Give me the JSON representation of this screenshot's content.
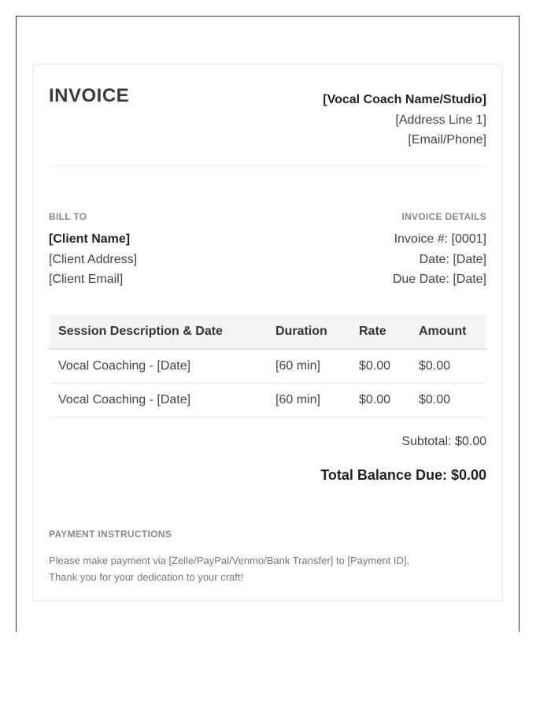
{
  "invoice": {
    "title": "INVOICE"
  },
  "studio": {
    "name": "[Vocal Coach Name/Studio]",
    "address": "[Address Line 1]",
    "contact": "[Email/Phone]"
  },
  "bill_to": {
    "label": "BILL TO",
    "client_name": "[Client Name]",
    "client_address": "[Client Address]",
    "client_email": "[Client Email]"
  },
  "details": {
    "label": "INVOICE DETAILS",
    "invoice_number": "Invoice #: [0001]",
    "date": "Date: [Date]",
    "due_date": "Due Date: [Date]"
  },
  "table": {
    "headers": [
      "Session Description & Date",
      "Duration",
      "Rate",
      "Amount"
    ],
    "rows": [
      [
        "Vocal Coaching - [Date]",
        "[60 min]",
        "$0.00",
        "$0.00"
      ],
      [
        "Vocal Coaching - [Date]",
        "[60 min]",
        "$0.00",
        "$0.00"
      ]
    ]
  },
  "totals": {
    "subtotal": "Subtotal: $0.00",
    "total_due": "Total Balance Due: $0.00"
  },
  "payment": {
    "label": "PAYMENT INSTRUCTIONS",
    "line1": "Please make payment via [Zelle/PayPal/Venmo/Bank Transfer] to [Payment ID].",
    "line2": "Thank you for your dedication to your craft!"
  }
}
